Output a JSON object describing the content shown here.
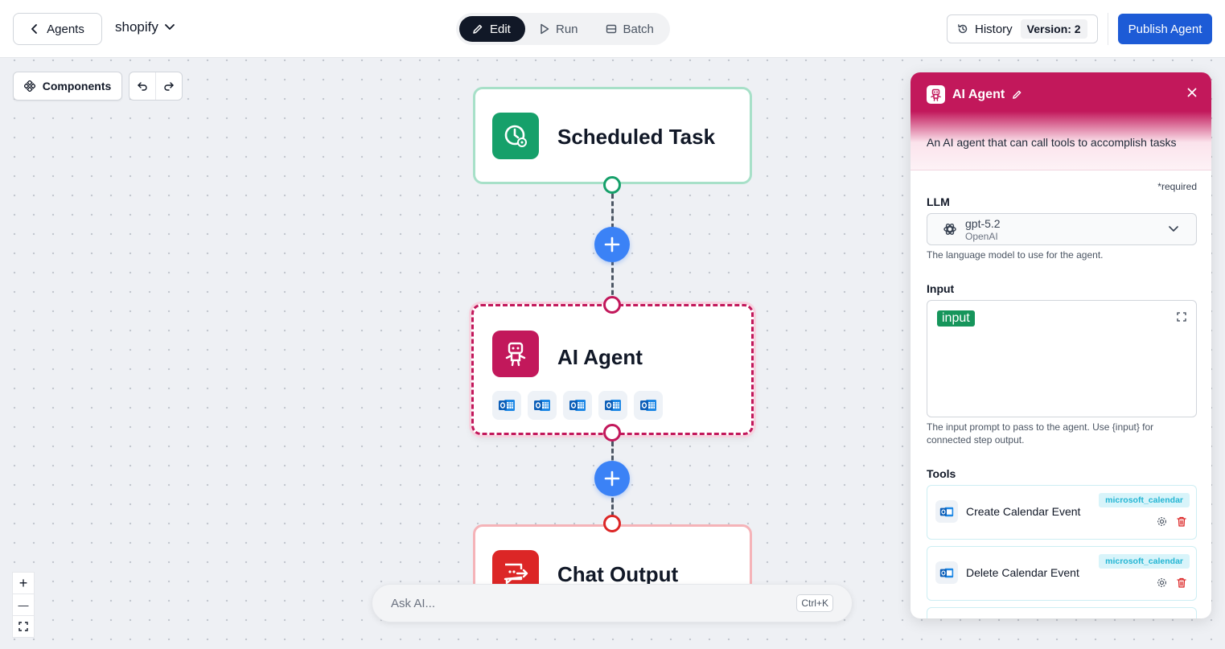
{
  "header": {
    "back_label": "Agents",
    "project_name": "shopify",
    "modes": [
      {
        "label": "Edit",
        "active": true
      },
      {
        "label": "Run",
        "active": false
      },
      {
        "label": "Batch",
        "active": false
      }
    ],
    "history_label": "History",
    "version_label": "Version: 2",
    "publish_label": "Publish Agent"
  },
  "canvas": {
    "components_label": "Components",
    "nodes": [
      {
        "title": "Scheduled Task",
        "icon": "clock-icon",
        "color": "#16a06a",
        "border": "#a7e0c8"
      },
      {
        "title": "AI Agent",
        "icon": "robot-icon",
        "color": "#c2185b",
        "border": "#c2185b",
        "tools": [
          "outlook-icon",
          "outlook-icon",
          "outlook-icon",
          "outlook-icon",
          "outlook-icon"
        ]
      },
      {
        "title": "Chat Output",
        "icon": "chat-output-icon",
        "color": "#dc2626",
        "border": "#f5b3b8"
      }
    ],
    "ask_ai_placeholder": "Ask AI...",
    "ask_ai_shortcut": "Ctrl+K",
    "zoom": {
      "in": "+",
      "out": "—",
      "fit": "fit-view-icon"
    }
  },
  "panel": {
    "title": "AI Agent",
    "description": "An AI agent that can call tools to accomplish tasks",
    "required_note": "*required",
    "llm_label": "LLM",
    "llm_model": "gpt-5.2",
    "llm_provider": "OpenAI",
    "llm_help": "The language model to use for the agent.",
    "input_label": "Input",
    "input_tag": "input",
    "input_help": "The input prompt to pass to the agent. Use {input} for connected step output.",
    "tools_label": "Tools",
    "tools": [
      {
        "name": "Create Calendar Event",
        "tag": "microsoft_calendar"
      },
      {
        "name": "Delete Calendar Event",
        "tag": "microsoft_calendar"
      }
    ],
    "accent": "#c2185b"
  }
}
